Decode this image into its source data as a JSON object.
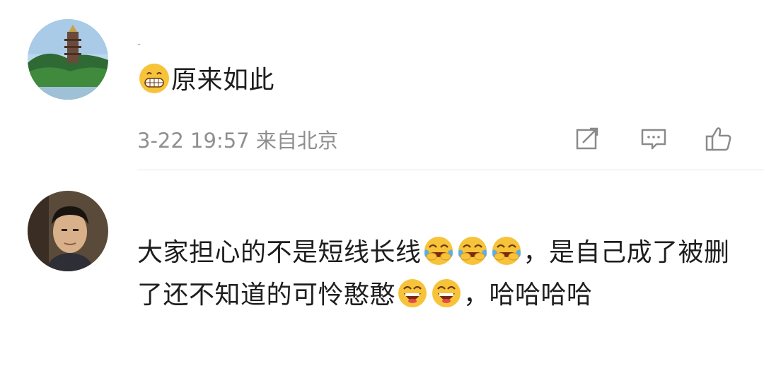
{
  "comments": [
    {
      "avatar_icon": "pagoda-landscape-avatar",
      "username": "-",
      "text_after_emoji": "原来如此",
      "emoji": "grinning-face-icon",
      "timestamp": "3-22 19:57",
      "location": "来自北京",
      "actions": [
        "share-icon",
        "comment-icon",
        "like-icon"
      ]
    },
    {
      "avatar_icon": "man-portrait-avatar",
      "text_part1": "大家担心的不是短线长线",
      "emoji_group1": [
        "tears-of-joy-icon",
        "tears-of-joy-icon",
        "tears-of-joy-icon"
      ],
      "text_part2": "，是自己成了被删了还不知道的可怜憨憨",
      "emoji_group2": [
        "laughing-face-icon",
        "laughing-face-icon"
      ],
      "text_part3": "，哈哈哈哈"
    }
  ],
  "colors": {
    "meta_text": "#8f8f8f",
    "divider": "#e6e6e6",
    "emoji_yellow": "#f7c33a"
  }
}
